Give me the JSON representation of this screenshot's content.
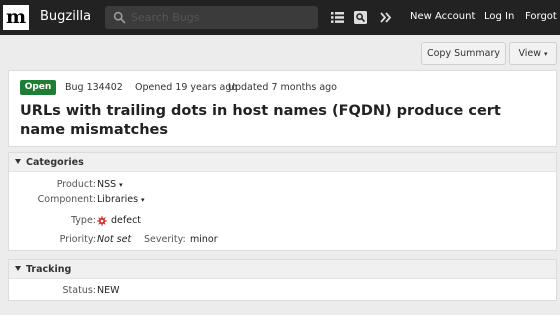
{
  "header": {
    "logo_letter": "m",
    "app_name": "Bugzilla",
    "search_placeholder": "Search Bugs",
    "icons": [
      "search-icon",
      "list-icon",
      "quicksearch-icon",
      "more-icon"
    ],
    "links": {
      "new_account": "New Account",
      "log_in": "Log In",
      "forgot": "Forgot"
    }
  },
  "toolbar": {
    "copy_summary": "Copy Summary",
    "view": "View",
    "view_caret": "▾"
  },
  "bug": {
    "status": "Open",
    "status_color": "#1e7e34",
    "id_label": "Bug 134402",
    "opened": "Opened 19 years ago",
    "updated": "Updated 7 months ago",
    "summary": "URLs with trailing dots in host names (FQDN) produce cert name mismatches"
  },
  "categories": {
    "title": "Categories",
    "product_label": "Product:",
    "product": "NSS",
    "component_label": "Component:",
    "component": "Libraries",
    "type_label": "Type:",
    "type": "defect",
    "type_icon": "defect-icon",
    "type_color": "#d0312d",
    "priority_label": "Priority:",
    "priority": "Not set",
    "severity_label": "Severity:",
    "severity": "minor"
  },
  "tracking": {
    "title": "Tracking",
    "status_label": "Status:",
    "status": "NEW"
  }
}
